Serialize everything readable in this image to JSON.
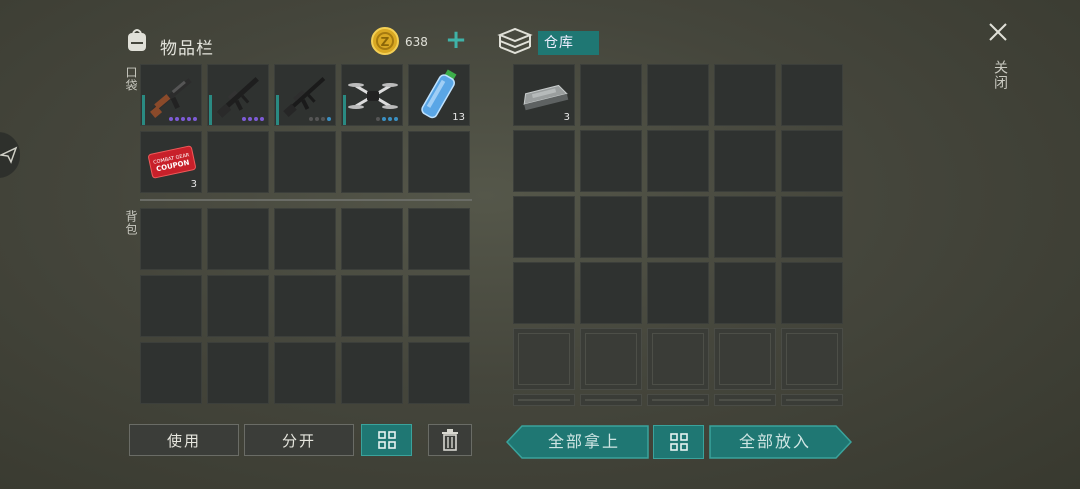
{
  "inventory": {
    "title": "物品栏",
    "currency_amount": "638",
    "pocket_label": "口袋",
    "backpack_label": "背包",
    "items": [
      {
        "name": "ak-rifle",
        "count": "",
        "rarity": [
          "#7d5bd6",
          "#7d5bd6",
          "#7d5bd6",
          "#7d5bd6",
          "#7d5bd6"
        ]
      },
      {
        "name": "m16-rifle",
        "count": "",
        "rarity": [
          "#7d5bd6",
          "#7d5bd6",
          "#7d5bd6",
          "#7d5bd6"
        ]
      },
      {
        "name": "m4-rifle",
        "count": "",
        "rarity": [
          "#555",
          "#555",
          "#555",
          "#3a8fc2"
        ]
      },
      {
        "name": "drone",
        "count": "",
        "rarity": [
          "#555",
          "#3a8fc2",
          "#3a8fc2",
          "#3a8fc2"
        ]
      },
      {
        "name": "water-bottle",
        "count": "13"
      },
      {
        "name": "coupon",
        "count": "3",
        "coupon_text": "COMBAT GEAR COUPON"
      }
    ]
  },
  "warehouse": {
    "title": "仓库",
    "items": [
      {
        "name": "metal-ingot",
        "count": "3"
      }
    ]
  },
  "close_label": "关闭",
  "buttons": {
    "use": "使用",
    "split": "分开",
    "take_all": "全部拿上",
    "put_all": "全部放入"
  },
  "colors": {
    "accent": "#1f7773",
    "accent_light": "#3aa39c",
    "coin": "#d9a823"
  }
}
